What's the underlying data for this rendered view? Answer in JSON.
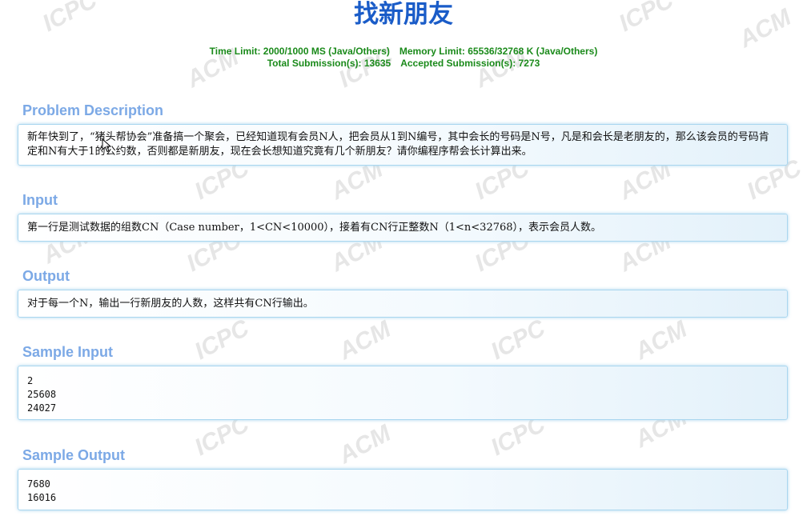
{
  "problem": {
    "title": "找新朋友",
    "time_limit": "Time Limit: 2000/1000 MS (Java/Others)",
    "memory_limit": "Memory Limit: 65536/32768 K (Java/Others)",
    "total_submissions": "Total Submission(s): 13635",
    "accepted_submissions": "Accepted Submission(s): 7273"
  },
  "watermark": {
    "texts": [
      "ICPC",
      "ACM"
    ]
  },
  "sections": {
    "description": {
      "heading": "Problem Description",
      "text": "新年快到了，“猪头帮协会”准备搞一个聚会，已经知道现有会员N人，把会员从1到N编号，其中会长的号码是N号，凡是和会长是老朋友的，那么该会员的号码肯定和N有大于1的公约数，否则都是新朋友，现在会长想知道究竟有几个新朋友？请你编程序帮会长计算出来。"
    },
    "input": {
      "heading": "Input",
      "text": "第一行是测试数据的组数CN（Case number，1<CN<10000），接着有CN行正整数N（1<n<32768），表示会员人数。"
    },
    "output": {
      "heading": "Output",
      "text": "对于每一个N，输出一行新朋友的人数，这样共有CN行输出。"
    },
    "sample_input": {
      "heading": "Sample Input",
      "text": "2\n25608\n24027"
    },
    "sample_output": {
      "heading": "Sample Output",
      "text": "7680\n16016"
    }
  },
  "colors": {
    "title": "#1a5cc8",
    "limits": "#1a8a1a",
    "heading": "#7ca9e6",
    "panel_border": "#a9d6ef",
    "watermark": "#e6e6e6"
  }
}
